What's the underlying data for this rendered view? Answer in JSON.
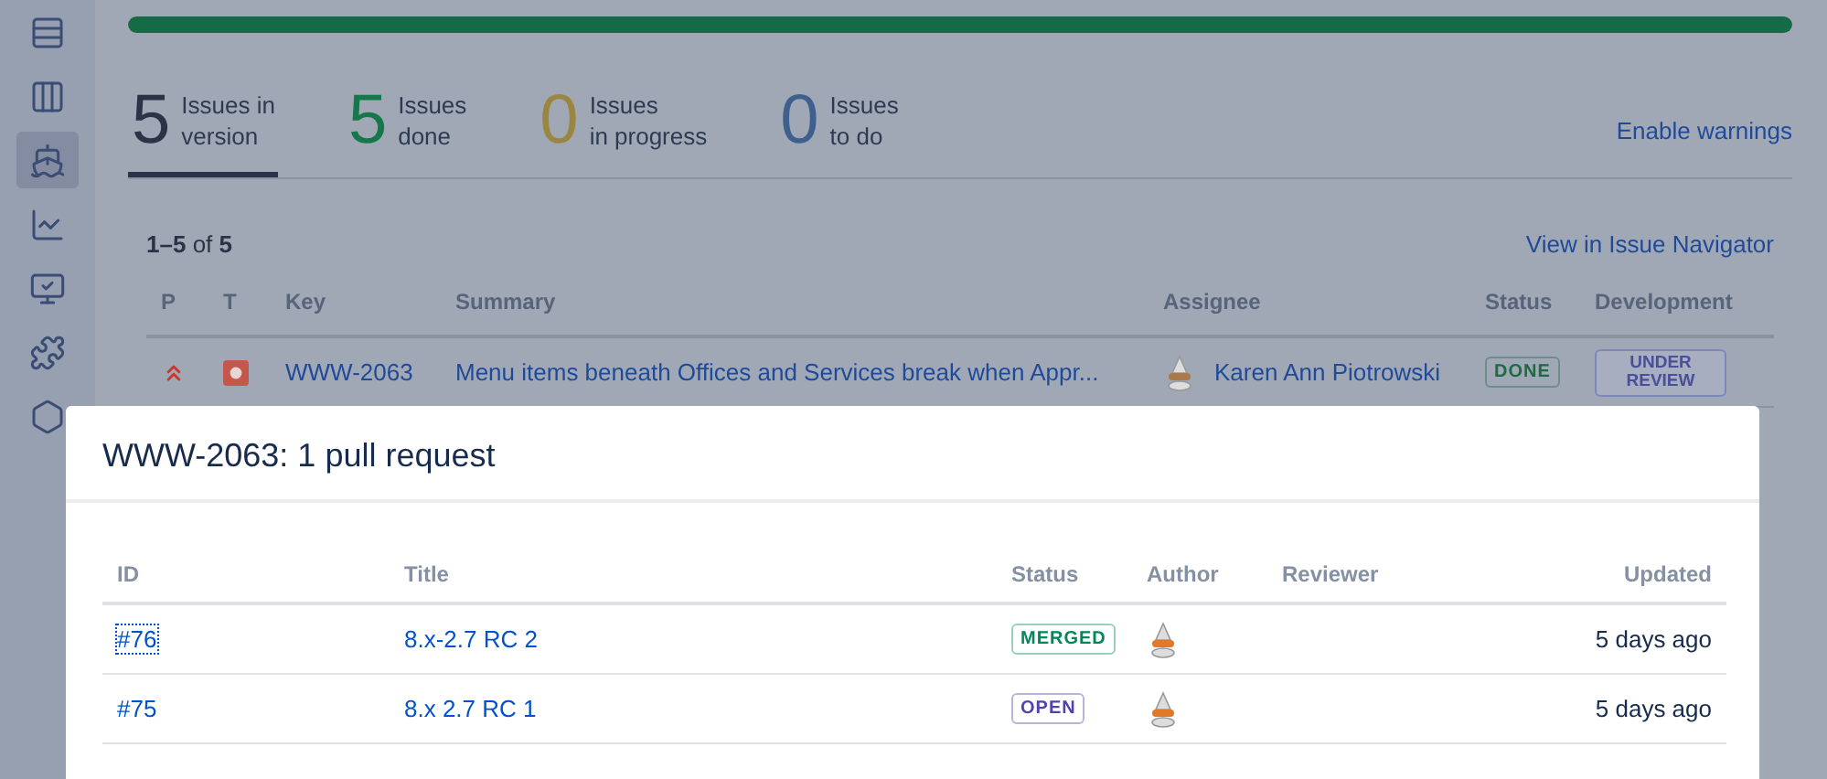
{
  "sidebar": {
    "items": [
      {
        "kind": "rows",
        "selected": false
      },
      {
        "kind": "columns",
        "selected": false
      },
      {
        "kind": "ship",
        "selected": true
      },
      {
        "kind": "chart",
        "selected": false
      },
      {
        "kind": "monitor",
        "selected": false
      },
      {
        "kind": "puzzle",
        "selected": false
      },
      {
        "kind": "hexagon",
        "selected": false
      }
    ]
  },
  "progress": {
    "level": 1
  },
  "stats": [
    {
      "count": "5",
      "lines": [
        "Issues in",
        "version"
      ],
      "color": "#2b3446",
      "selected": true
    },
    {
      "count": "5",
      "lines": [
        "Issues",
        "done"
      ],
      "color": "#16784a",
      "selected": false
    },
    {
      "count": "0",
      "lines": [
        "Issues",
        "in progress"
      ],
      "color": "#9a8640",
      "selected": false
    },
    {
      "count": "0",
      "lines": [
        "Issues",
        "to do"
      ],
      "color": "#3f5f8f",
      "selected": false
    }
  ],
  "enable_warnings": "Enable warnings",
  "issues": {
    "range": "1–5",
    "of": "of",
    "total": "5",
    "navigator_link": "View in Issue Navigator",
    "columns": [
      "P",
      "T",
      "Key",
      "Summary",
      "Assignee",
      "Status",
      "Development"
    ],
    "rows": [
      {
        "key": "WWW-2063",
        "summary": "Menu items beneath Offices and Services break when Appr...",
        "assignee": "Karen Ann Piotrowski",
        "status": "DONE",
        "development": "UNDER REVIEW"
      }
    ]
  },
  "dialog": {
    "title": "WWW-2063: 1 pull request",
    "columns": [
      "ID",
      "Title",
      "Status",
      "Author",
      "Reviewer",
      "Updated"
    ],
    "rows": [
      {
        "id": "#76",
        "focused": true,
        "title": "8.x-2.7 RC 2",
        "status": "MERGED",
        "color": "#00875a",
        "updated": "5 days ago"
      },
      {
        "id": "#75",
        "focused": false,
        "title": "8.x 2.7 RC 1",
        "status": "OPEN",
        "color": "#5243aa",
        "updated": "5 days ago"
      }
    ]
  }
}
